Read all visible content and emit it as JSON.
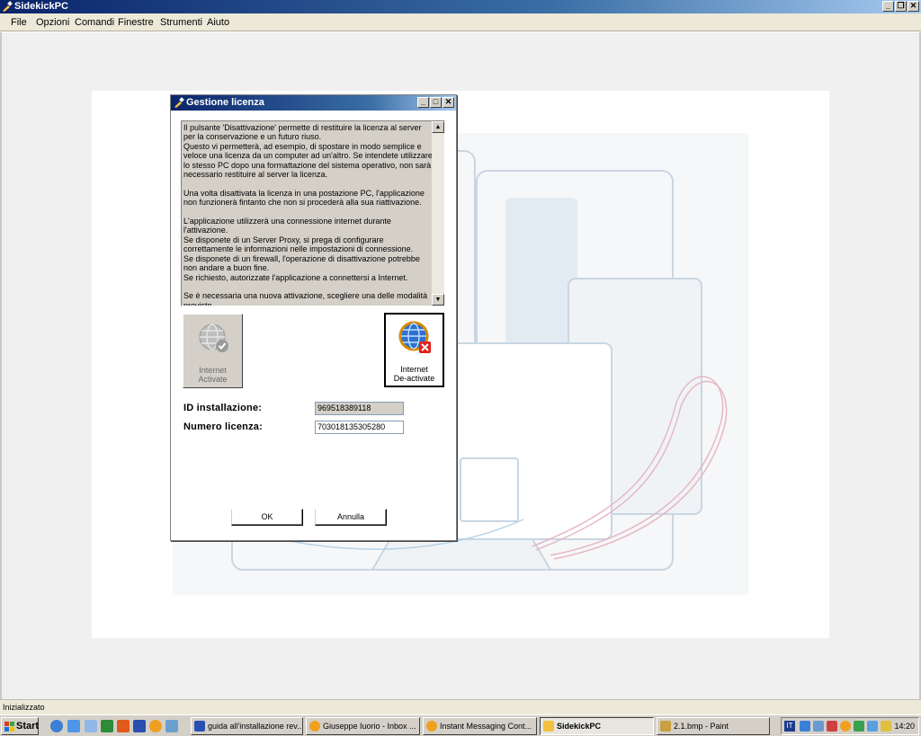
{
  "window": {
    "title": "SidekickPC"
  },
  "menu": [
    "File",
    "Opzioni",
    "Comandi",
    "Finestre",
    "Strumenti",
    "Aiuto"
  ],
  "dialog": {
    "title": "Gestione licenza",
    "info_text": "Il pulsante 'Disattivazione' permette di restituire la licenza al server per la conservazione e un futuro riuso.\nQuesto vi permetterà, ad esempio, di spostare in modo semplice e veloce una licenza da un computer ad un'altro. Se intendete utilizzare lo stesso PC dopo una formattazione del sistema operativo, non sarà necessario restituire al server la licenza.\n\nUna volta disattivata la licenza in una postazione PC, l'applicazione non funzionerà fintanto che non si procederà alla sua riattivazione.\n\nL'applicazione utilizzerà una connessione internet durante l'attivazione.\nSe disponete di un Server Proxy, si prega di configurare correttamente le informazioni nelle impostazioni di connessione.\nSe disponete di un firewall, l'operazione di disattivazione potrebbe non andare a buon fine.\nSe richiesto, autorizzate l'applicazione a connettersi a Internet.\n\nSe è necessaria una nuova attivazione, scegliere una delle modalità previste.",
    "activate_label": "Internet\nActivate",
    "deactivate_label": "Internet\nDe-activate",
    "id_label": "ID installazione:",
    "id_value": "969518389118",
    "license_label": "Numero licenza:",
    "license_value": "703018135305280",
    "ok": "OK",
    "cancel": "Annulla"
  },
  "status": "Inizializzato",
  "taskbar": {
    "start": "Start",
    "tasks": [
      "guida all'installazione rev...",
      "Giuseppe Iuorio - Inbox ...",
      "Instant Messaging Cont...",
      "SidekickPC",
      "2.1.bmp - Paint"
    ],
    "lang": "IT",
    "clock": "14:20"
  },
  "colors": {
    "titlebar": "#0a246a",
    "dialog_text_bg": "#d4d0c8",
    "taskbar": "#d4d0c8"
  }
}
